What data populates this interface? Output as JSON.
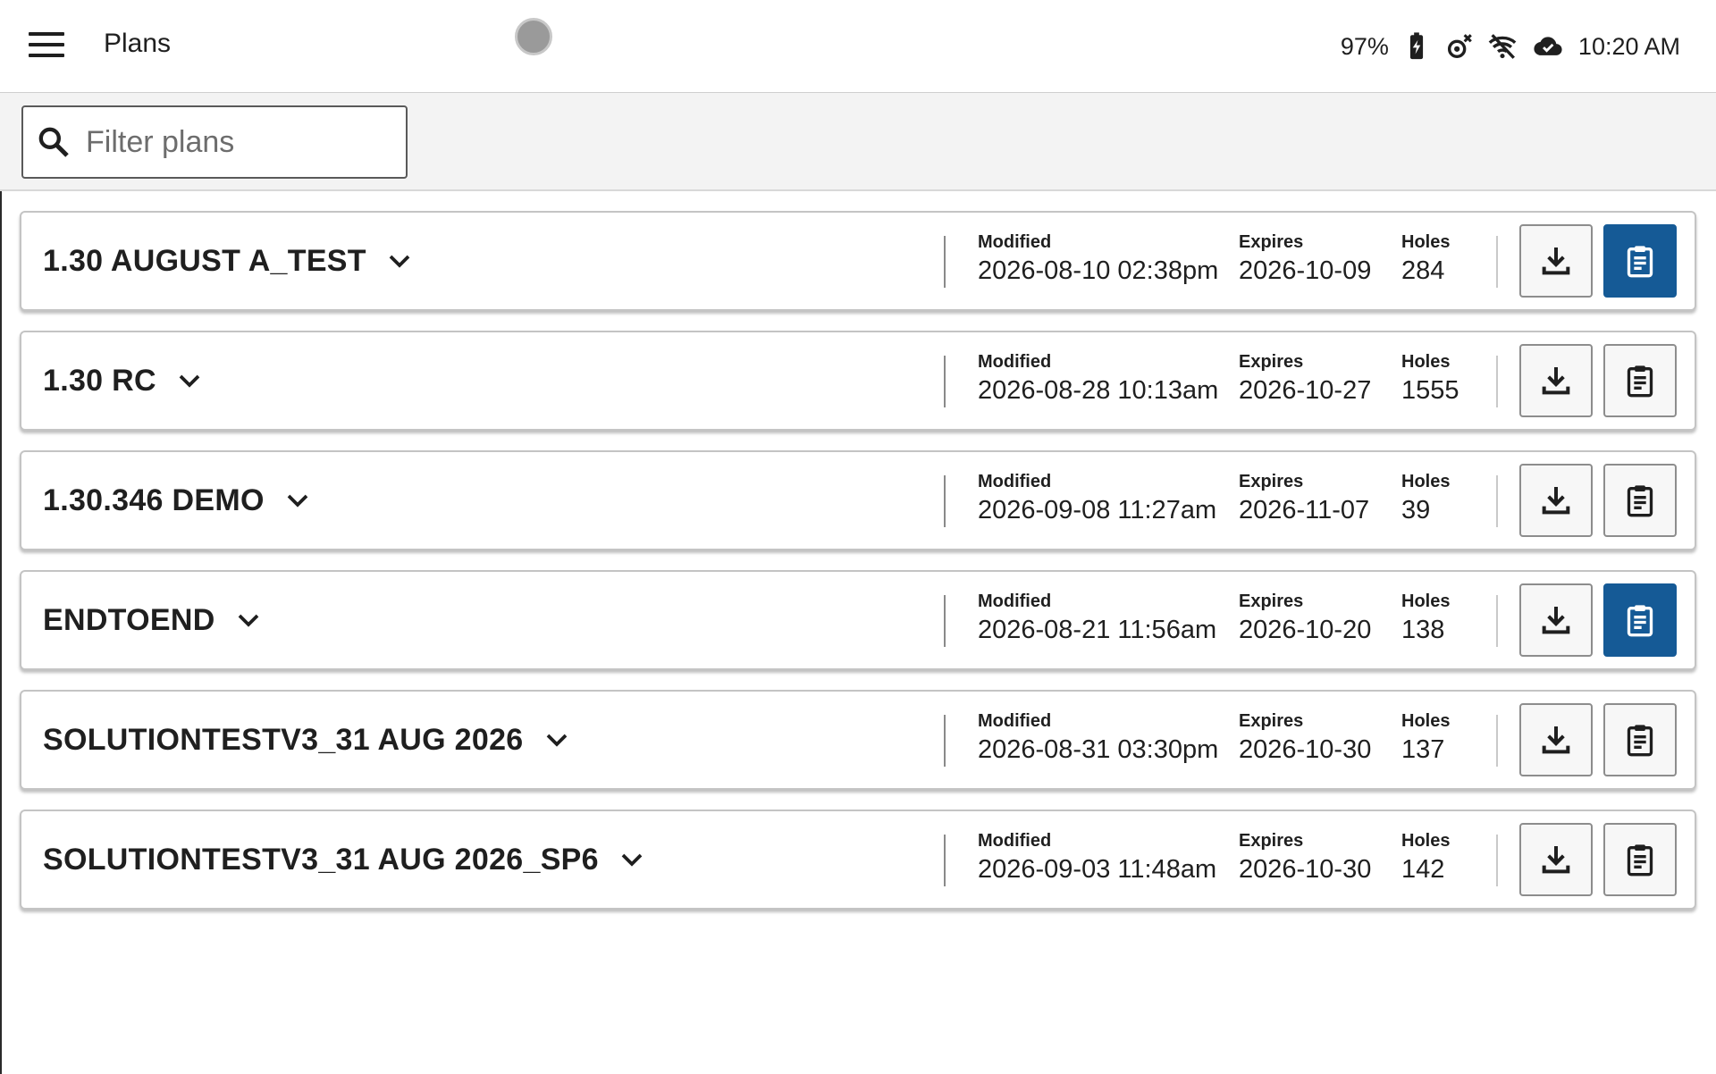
{
  "header": {
    "title": "Plans",
    "battery": "97%",
    "time": "10:20 AM"
  },
  "icons": {
    "menu": "hamburger-menu-icon",
    "battery": "battery-charging-icon",
    "gps": "gps-off-icon",
    "wifi": "wifi-off-icon",
    "cloud": "cloud-done-icon",
    "search": "search-icon",
    "expand": "chevron-down-icon",
    "download": "download-icon",
    "clipboard": "clipboard-icon"
  },
  "filter": {
    "placeholder": "Filter plans",
    "value": ""
  },
  "labels": {
    "modified": "Modified",
    "expires": "Expires",
    "holes": "Holes"
  },
  "colors": {
    "accent": "#155a96",
    "border": "#c4c4c4"
  },
  "plans": [
    {
      "name": "1.30 AUGUST A_TEST",
      "modified": "2026-08-10 02:38pm",
      "expires": "2026-10-09",
      "holes": "284",
      "active": true
    },
    {
      "name": "1.30 RC",
      "modified": "2026-08-28 10:13am",
      "expires": "2026-10-27",
      "holes": "1555",
      "active": false
    },
    {
      "name": "1.30.346 DEMO",
      "modified": "2026-09-08 11:27am",
      "expires": "2026-11-07",
      "holes": "39",
      "active": false
    },
    {
      "name": "ENDTOEND",
      "modified": "2026-08-21 11:56am",
      "expires": "2026-10-20",
      "holes": "138",
      "active": true
    },
    {
      "name": "SOLUTIONTESTV3_31 AUG 2026",
      "modified": "2026-08-31 03:30pm",
      "expires": "2026-10-30",
      "holes": "137",
      "active": false
    },
    {
      "name": "SOLUTIONTESTV3_31 AUG 2026_SP6",
      "modified": "2026-09-03 11:48am",
      "expires": "2026-10-30",
      "holes": "142",
      "active": false
    }
  ]
}
